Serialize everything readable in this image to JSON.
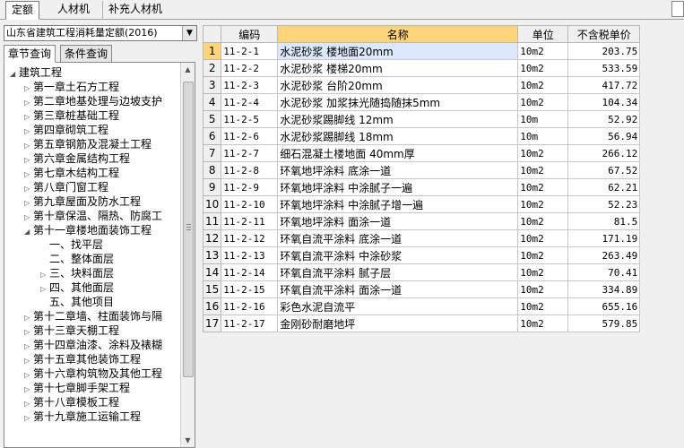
{
  "top_tabs": [
    {
      "label": "定额",
      "active": true
    },
    {
      "label": "人材机",
      "active": false
    },
    {
      "label": "补充人材机",
      "active": false
    }
  ],
  "left": {
    "combo_value": "山东省建筑工程消耗量定额(2016)",
    "sub_tabs": [
      {
        "label": "章节查询",
        "active": true
      },
      {
        "label": "条件查询",
        "active": false
      }
    ],
    "tree": [
      {
        "label": "建筑工程",
        "level": 0,
        "toggle": "expanded"
      },
      {
        "label": "第一章土石方工程",
        "level": 1,
        "toggle": "collapsed"
      },
      {
        "label": "第二章地基处理与边坡支护",
        "level": 1,
        "toggle": "collapsed"
      },
      {
        "label": "第三章桩基础工程",
        "level": 1,
        "toggle": "collapsed"
      },
      {
        "label": "第四章砌筑工程",
        "level": 1,
        "toggle": "collapsed"
      },
      {
        "label": "第五章钢筋及混凝土工程",
        "level": 1,
        "toggle": "collapsed"
      },
      {
        "label": "第六章金属结构工程",
        "level": 1,
        "toggle": "collapsed"
      },
      {
        "label": "第七章木结构工程",
        "level": 1,
        "toggle": "collapsed"
      },
      {
        "label": "第八章门窗工程",
        "level": 1,
        "toggle": "collapsed"
      },
      {
        "label": "第九章屋面及防水工程",
        "level": 1,
        "toggle": "collapsed"
      },
      {
        "label": "第十章保温、隔热、防腐工",
        "level": 1,
        "toggle": "collapsed"
      },
      {
        "label": "第十一章楼地面装饰工程",
        "level": 1,
        "toggle": "expanded"
      },
      {
        "label": "一、找平层",
        "level": 2,
        "toggle": "none"
      },
      {
        "label": "二、整体面层",
        "level": 2,
        "toggle": "none"
      },
      {
        "label": "三、块料面层",
        "level": 2,
        "toggle": "collapsed"
      },
      {
        "label": "四、其他面层",
        "level": 2,
        "toggle": "collapsed"
      },
      {
        "label": "五、其他项目",
        "level": 2,
        "toggle": "none"
      },
      {
        "label": "第十二章墙、柱面装饰与隔",
        "level": 1,
        "toggle": "collapsed"
      },
      {
        "label": "第十三章天棚工程",
        "level": 1,
        "toggle": "collapsed"
      },
      {
        "label": "第十四章油漆、涂料及裱糊",
        "level": 1,
        "toggle": "collapsed"
      },
      {
        "label": "第十五章其他装饰工程",
        "level": 1,
        "toggle": "collapsed"
      },
      {
        "label": "第十六章构筑物及其他工程",
        "level": 1,
        "toggle": "collapsed"
      },
      {
        "label": "第十七章脚手架工程",
        "level": 1,
        "toggle": "collapsed"
      },
      {
        "label": "第十八章模板工程",
        "level": 1,
        "toggle": "collapsed"
      },
      {
        "label": "第十九章施工运输工程",
        "level": 1,
        "toggle": "collapsed"
      }
    ]
  },
  "grid": {
    "columns": [
      "编码",
      "名称",
      "单位",
      "不含税单价"
    ],
    "selected_row": 1,
    "rows": [
      {
        "no": "1",
        "code": "11-2-1",
        "name": "水泥砂浆 楼地面20mm",
        "unit": "10m2",
        "price": "203.75"
      },
      {
        "no": "2",
        "code": "11-2-2",
        "name": "水泥砂浆 楼梯20mm",
        "unit": "10m2",
        "price": "533.59"
      },
      {
        "no": "3",
        "code": "11-2-3",
        "name": "水泥砂浆 台阶20mm",
        "unit": "10m2",
        "price": "417.72"
      },
      {
        "no": "4",
        "code": "11-2-4",
        "name": "水泥砂浆 加浆抹光随捣随抹5mm",
        "unit": "10m2",
        "price": "104.34"
      },
      {
        "no": "5",
        "code": "11-2-5",
        "name": "水泥砂浆踢脚线 12mm",
        "unit": "10m",
        "price": "52.92"
      },
      {
        "no": "6",
        "code": "11-2-6",
        "name": "水泥砂浆踢脚线 18mm",
        "unit": "10m",
        "price": "56.94"
      },
      {
        "no": "7",
        "code": "11-2-7",
        "name": "细石混凝土楼地面 40mm厚",
        "unit": "10m2",
        "price": "266.12"
      },
      {
        "no": "8",
        "code": "11-2-8",
        "name": "环氧地坪涂料 底涂一道",
        "unit": "10m2",
        "price": "67.52"
      },
      {
        "no": "9",
        "code": "11-2-9",
        "name": "环氧地坪涂料 中涂腻子一遍",
        "unit": "10m2",
        "price": "62.21"
      },
      {
        "no": "10",
        "code": "11-2-10",
        "name": "环氧地坪涂料 中涂腻子增一遍",
        "unit": "10m2",
        "price": "52.23"
      },
      {
        "no": "11",
        "code": "11-2-11",
        "name": "环氧地坪涂料 面涂一道",
        "unit": "10m2",
        "price": "81.5"
      },
      {
        "no": "12",
        "code": "11-2-12",
        "name": "环氧自流平涂料 底涂一道",
        "unit": "10m2",
        "price": "171.19"
      },
      {
        "no": "13",
        "code": "11-2-13",
        "name": "环氧自流平涂料 中涂砂浆",
        "unit": "10m2",
        "price": "263.49"
      },
      {
        "no": "14",
        "code": "11-2-14",
        "name": "环氧自流平涂料 腻子层",
        "unit": "10m2",
        "price": "70.41"
      },
      {
        "no": "15",
        "code": "11-2-15",
        "name": "环氧自流平涂料 面涂一道",
        "unit": "10m2",
        "price": "334.89"
      },
      {
        "no": "16",
        "code": "11-2-16",
        "name": "彩色水泥自流平",
        "unit": "10m2",
        "price": "655.16"
      },
      {
        "no": "17",
        "code": "11-2-17",
        "name": "金刚砂耐磨地坪",
        "unit": "10m2",
        "price": "579.85"
      }
    ]
  }
}
